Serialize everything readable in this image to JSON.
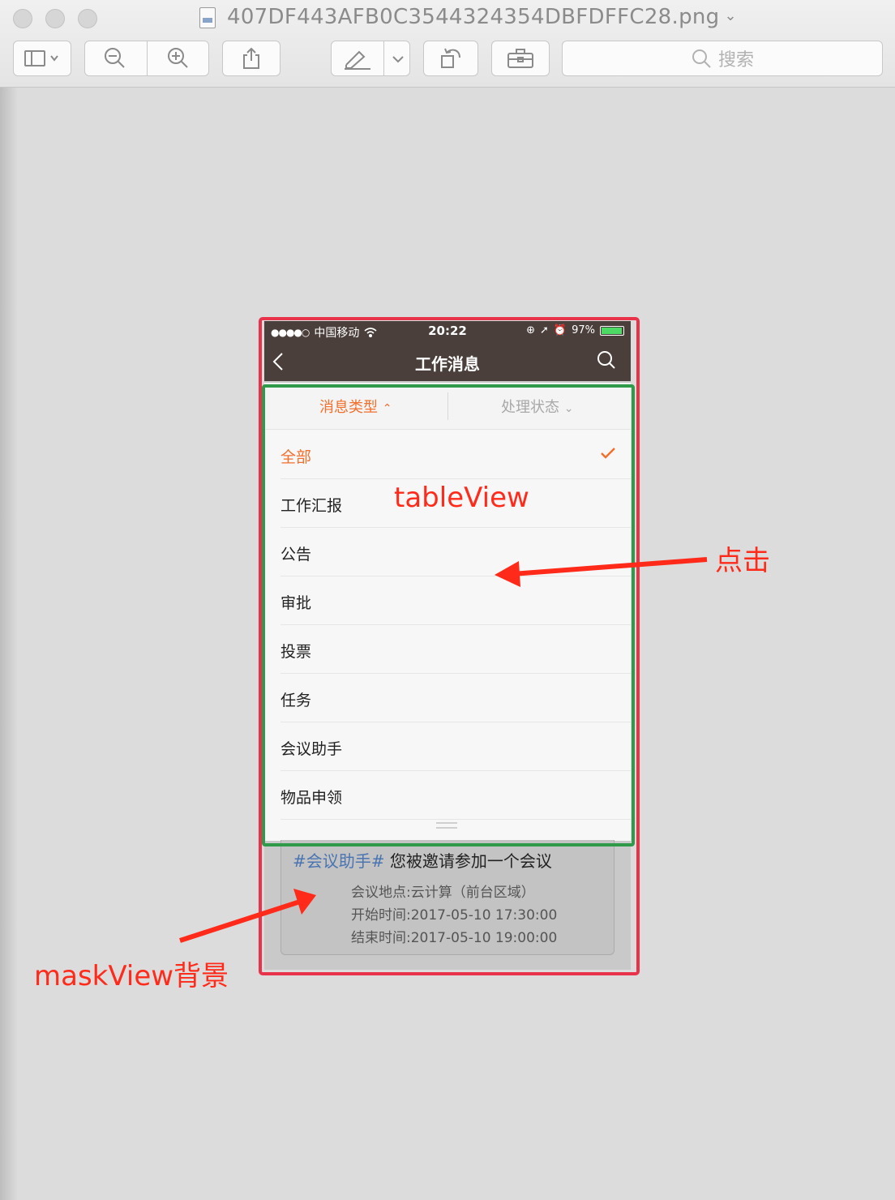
{
  "window": {
    "file_name": "407DF443AFB0C3544324354DBFDFFC28.png",
    "search_placeholder": "搜索",
    "toolbar_icons": [
      "sidebar-icon",
      "zoom-out-icon",
      "zoom-in-icon",
      "share-icon",
      "markup-icon",
      "rotate-icon",
      "toolbox-icon"
    ]
  },
  "phone": {
    "status": {
      "carrier": "中国移动",
      "time": "20:22",
      "battery": "97%",
      "battery_level": 0.97
    },
    "nav_title": "工作消息",
    "tabs": [
      {
        "label": "消息类型",
        "arrow": "⌃"
      },
      {
        "label": "处理状态",
        "arrow": "⌄"
      }
    ],
    "rows": [
      {
        "label": "全部",
        "selected": true
      },
      {
        "label": "工作汇报",
        "selected": false
      },
      {
        "label": "公告",
        "selected": false
      },
      {
        "label": "审批",
        "selected": false
      },
      {
        "label": "投票",
        "selected": false
      },
      {
        "label": "任务",
        "selected": false
      },
      {
        "label": "会议助手",
        "selected": false
      },
      {
        "label": "物品申领",
        "selected": false
      }
    ],
    "card": {
      "tag": "#会议助手#",
      "title": " 您被邀请参加一个会议",
      "location": "会议地点:云计算（前台区域）",
      "start": "开始时间:2017-05-10 17:30:00",
      "end": "结束时间:2017-05-10 19:00:00"
    }
  },
  "annotations": {
    "table_label": "tableView",
    "click_label": "点击",
    "mask_label": "maskView背景"
  },
  "colors": {
    "accent": "#f26f2c",
    "nav_bg": "#4a3f3a",
    "annotation_red": "#ff2a1a",
    "green_box": "#2e9a4a"
  }
}
